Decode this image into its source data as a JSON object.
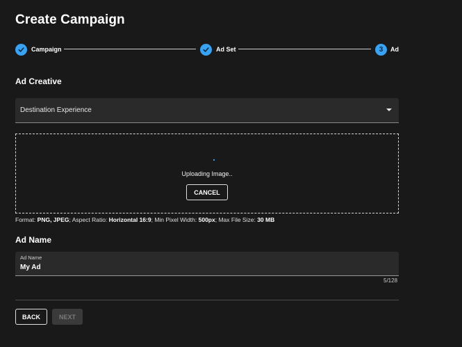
{
  "page": {
    "title": "Create Campaign"
  },
  "stepper": {
    "steps": [
      {
        "label": "Campaign",
        "state": "completed",
        "icon": "check-icon"
      },
      {
        "label": "Ad Set",
        "state": "completed",
        "icon": "check-icon"
      },
      {
        "label": "Ad",
        "state": "active",
        "number": "3"
      }
    ],
    "accent_color": "#3aa2f2"
  },
  "ad_creative": {
    "heading": "Ad Creative",
    "select_value": "Destination Experience",
    "upload": {
      "status": "Uploading Image..",
      "cancel_label": "CANCEL"
    },
    "hint": {
      "format_label": "Format: ",
      "format_value": "PNG, JPEG",
      "aspect_label": "; Aspect Ratio: ",
      "aspect_value": "Horizontal 16:9",
      "width_label": "; Min Pixel Width: ",
      "width_value": "500px",
      "size_label": "; Max File Size: ",
      "size_value": "30 MB"
    }
  },
  "ad_name": {
    "heading": "Ad Name",
    "field_label": "Ad Name",
    "value": "My Ad",
    "counter": "5/128"
  },
  "footer": {
    "back_label": "BACK",
    "next_label": "NEXT"
  }
}
